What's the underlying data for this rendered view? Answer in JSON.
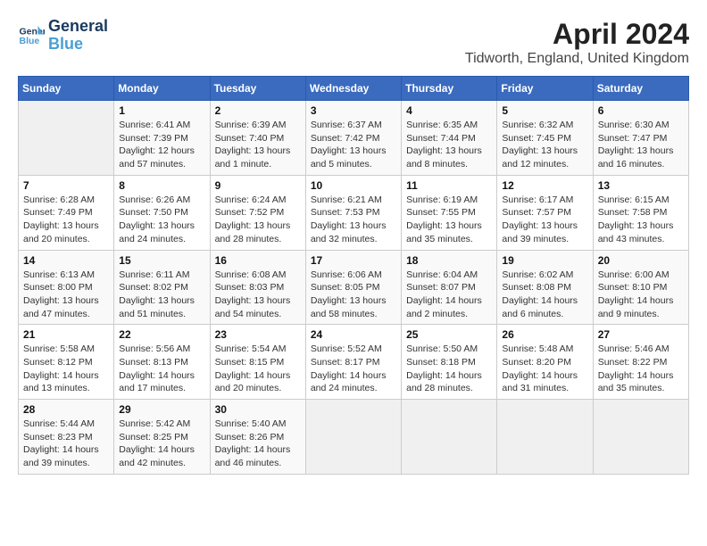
{
  "header": {
    "logo_line1": "General",
    "logo_line2": "Blue",
    "title": "April 2024",
    "subtitle": "Tidworth, England, United Kingdom"
  },
  "weekdays": [
    "Sunday",
    "Monday",
    "Tuesday",
    "Wednesday",
    "Thursday",
    "Friday",
    "Saturday"
  ],
  "weeks": [
    [
      {
        "date": "",
        "info": ""
      },
      {
        "date": "1",
        "info": "Sunrise: 6:41 AM\nSunset: 7:39 PM\nDaylight: 12 hours\nand 57 minutes."
      },
      {
        "date": "2",
        "info": "Sunrise: 6:39 AM\nSunset: 7:40 PM\nDaylight: 13 hours\nand 1 minute."
      },
      {
        "date": "3",
        "info": "Sunrise: 6:37 AM\nSunset: 7:42 PM\nDaylight: 13 hours\nand 5 minutes."
      },
      {
        "date": "4",
        "info": "Sunrise: 6:35 AM\nSunset: 7:44 PM\nDaylight: 13 hours\nand 8 minutes."
      },
      {
        "date": "5",
        "info": "Sunrise: 6:32 AM\nSunset: 7:45 PM\nDaylight: 13 hours\nand 12 minutes."
      },
      {
        "date": "6",
        "info": "Sunrise: 6:30 AM\nSunset: 7:47 PM\nDaylight: 13 hours\nand 16 minutes."
      }
    ],
    [
      {
        "date": "7",
        "info": "Sunrise: 6:28 AM\nSunset: 7:49 PM\nDaylight: 13 hours\nand 20 minutes."
      },
      {
        "date": "8",
        "info": "Sunrise: 6:26 AM\nSunset: 7:50 PM\nDaylight: 13 hours\nand 24 minutes."
      },
      {
        "date": "9",
        "info": "Sunrise: 6:24 AM\nSunset: 7:52 PM\nDaylight: 13 hours\nand 28 minutes."
      },
      {
        "date": "10",
        "info": "Sunrise: 6:21 AM\nSunset: 7:53 PM\nDaylight: 13 hours\nand 32 minutes."
      },
      {
        "date": "11",
        "info": "Sunrise: 6:19 AM\nSunset: 7:55 PM\nDaylight: 13 hours\nand 35 minutes."
      },
      {
        "date": "12",
        "info": "Sunrise: 6:17 AM\nSunset: 7:57 PM\nDaylight: 13 hours\nand 39 minutes."
      },
      {
        "date": "13",
        "info": "Sunrise: 6:15 AM\nSunset: 7:58 PM\nDaylight: 13 hours\nand 43 minutes."
      }
    ],
    [
      {
        "date": "14",
        "info": "Sunrise: 6:13 AM\nSunset: 8:00 PM\nDaylight: 13 hours\nand 47 minutes."
      },
      {
        "date": "15",
        "info": "Sunrise: 6:11 AM\nSunset: 8:02 PM\nDaylight: 13 hours\nand 51 minutes."
      },
      {
        "date": "16",
        "info": "Sunrise: 6:08 AM\nSunset: 8:03 PM\nDaylight: 13 hours\nand 54 minutes."
      },
      {
        "date": "17",
        "info": "Sunrise: 6:06 AM\nSunset: 8:05 PM\nDaylight: 13 hours\nand 58 minutes."
      },
      {
        "date": "18",
        "info": "Sunrise: 6:04 AM\nSunset: 8:07 PM\nDaylight: 14 hours\nand 2 minutes."
      },
      {
        "date": "19",
        "info": "Sunrise: 6:02 AM\nSunset: 8:08 PM\nDaylight: 14 hours\nand 6 minutes."
      },
      {
        "date": "20",
        "info": "Sunrise: 6:00 AM\nSunset: 8:10 PM\nDaylight: 14 hours\nand 9 minutes."
      }
    ],
    [
      {
        "date": "21",
        "info": "Sunrise: 5:58 AM\nSunset: 8:12 PM\nDaylight: 14 hours\nand 13 minutes."
      },
      {
        "date": "22",
        "info": "Sunrise: 5:56 AM\nSunset: 8:13 PM\nDaylight: 14 hours\nand 17 minutes."
      },
      {
        "date": "23",
        "info": "Sunrise: 5:54 AM\nSunset: 8:15 PM\nDaylight: 14 hours\nand 20 minutes."
      },
      {
        "date": "24",
        "info": "Sunrise: 5:52 AM\nSunset: 8:17 PM\nDaylight: 14 hours\nand 24 minutes."
      },
      {
        "date": "25",
        "info": "Sunrise: 5:50 AM\nSunset: 8:18 PM\nDaylight: 14 hours\nand 28 minutes."
      },
      {
        "date": "26",
        "info": "Sunrise: 5:48 AM\nSunset: 8:20 PM\nDaylight: 14 hours\nand 31 minutes."
      },
      {
        "date": "27",
        "info": "Sunrise: 5:46 AM\nSunset: 8:22 PM\nDaylight: 14 hours\nand 35 minutes."
      }
    ],
    [
      {
        "date": "28",
        "info": "Sunrise: 5:44 AM\nSunset: 8:23 PM\nDaylight: 14 hours\nand 39 minutes."
      },
      {
        "date": "29",
        "info": "Sunrise: 5:42 AM\nSunset: 8:25 PM\nDaylight: 14 hours\nand 42 minutes."
      },
      {
        "date": "30",
        "info": "Sunrise: 5:40 AM\nSunset: 8:26 PM\nDaylight: 14 hours\nand 46 minutes."
      },
      {
        "date": "",
        "info": ""
      },
      {
        "date": "",
        "info": ""
      },
      {
        "date": "",
        "info": ""
      },
      {
        "date": "",
        "info": ""
      }
    ]
  ]
}
